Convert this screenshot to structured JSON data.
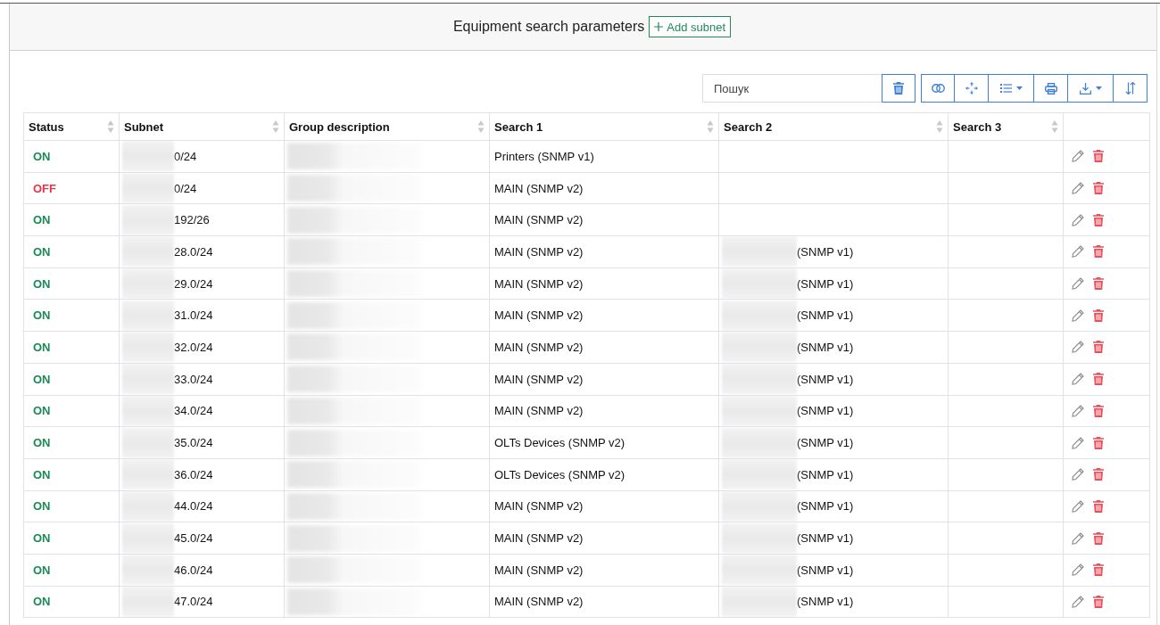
{
  "title": "Equipment search parameters",
  "add_button": {
    "label": "Add subnet"
  },
  "search": {
    "placeholder": "Пошук"
  },
  "table": {
    "columns": [
      {
        "label": "Status",
        "sortable": true
      },
      {
        "label": "Subnet",
        "sortable": true
      },
      {
        "label": "Group description",
        "sortable": true
      },
      {
        "label": "Search 1",
        "sortable": true
      },
      {
        "label": "Search 2",
        "sortable": true
      },
      {
        "label": "Search 3",
        "sortable": true
      }
    ],
    "rows": [
      {
        "status": {
          "label": "ON",
          "on": true
        },
        "subnet": "0/24",
        "search_1": "Printers (SNMP v1)"
      },
      {
        "status": {
          "label": "OFF",
          "on": false
        },
        "subnet": "0/24",
        "search_1": "MAIN (SNMP v2)"
      },
      {
        "status": {
          "label": "ON",
          "on": true
        },
        "subnet": "192/26",
        "search_1": "MAIN (SNMP v2)"
      },
      {
        "status": {
          "label": "ON",
          "on": true
        },
        "subnet": "28.0/24",
        "search_1": "MAIN (SNMP v2)",
        "search_2": "(SNMP v1)"
      },
      {
        "status": {
          "label": "ON",
          "on": true
        },
        "subnet": "29.0/24",
        "search_1": "MAIN (SNMP v2)",
        "search_2": "(SNMP v1)"
      },
      {
        "status": {
          "label": "ON",
          "on": true
        },
        "subnet": "31.0/24",
        "search_1": "MAIN (SNMP v2)",
        "search_2": "(SNMP v1)"
      },
      {
        "status": {
          "label": "ON",
          "on": true
        },
        "subnet": "32.0/24",
        "search_1": "MAIN (SNMP v2)",
        "search_2": "(SNMP v1)"
      },
      {
        "status": {
          "label": "ON",
          "on": true
        },
        "subnet": "33.0/24",
        "search_1": "MAIN (SNMP v2)",
        "search_2": "(SNMP v1)"
      },
      {
        "status": {
          "label": "ON",
          "on": true
        },
        "subnet": "34.0/24",
        "search_1": "MAIN (SNMP v2)",
        "search_2": "(SNMP v1)"
      },
      {
        "status": {
          "label": "ON",
          "on": true
        },
        "subnet": "35.0/24",
        "search_1": "OLTs Devices (SNMP v2)",
        "search_2": "(SNMP v1)"
      },
      {
        "status": {
          "label": "ON",
          "on": true
        },
        "subnet": "36.0/24",
        "search_1": "OLTs Devices (SNMP v2)",
        "search_2": "(SNMP v1)"
      },
      {
        "status": {
          "label": "ON",
          "on": true
        },
        "subnet": "44.0/24",
        "search_1": "MAIN (SNMP v2)",
        "search_2": "(SNMP v1)"
      },
      {
        "status": {
          "label": "ON",
          "on": true
        },
        "subnet": "45.0/24",
        "search_1": "MAIN (SNMP v2)",
        "search_2": "(SNMP v1)"
      },
      {
        "status": {
          "label": "ON",
          "on": true
        },
        "subnet": "46.0/24",
        "search_1": "MAIN (SNMP v2)",
        "search_2": "(SNMP v1)"
      },
      {
        "status": {
          "label": "ON",
          "on": true
        },
        "subnet": "47.0/24",
        "search_1": "MAIN (SNMP v2)",
        "search_2": "(SNMP v1)"
      }
    ]
  }
}
